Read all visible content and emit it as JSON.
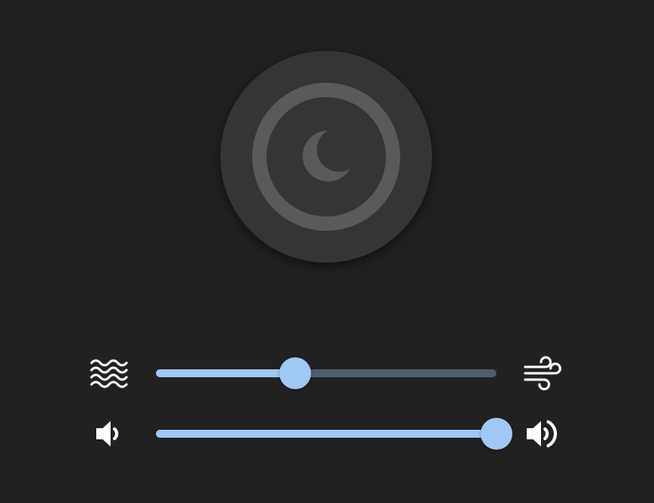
{
  "sleep_button": {
    "icon": "moon-icon",
    "state": "off"
  },
  "noise_slider": {
    "left_icon": "waves-icon",
    "right_icon": "wind-icon",
    "value": 0.41
  },
  "volume_slider": {
    "left_icon": "volume-low-icon",
    "right_icon": "volume-high-icon",
    "value": 1.0
  },
  "colors": {
    "background": "#212121",
    "button": "#353535",
    "ring": "#5a5a5a",
    "accent": "#9fc8f5",
    "track_inactive": "#4e5c6d",
    "icon": "#ffffff"
  }
}
